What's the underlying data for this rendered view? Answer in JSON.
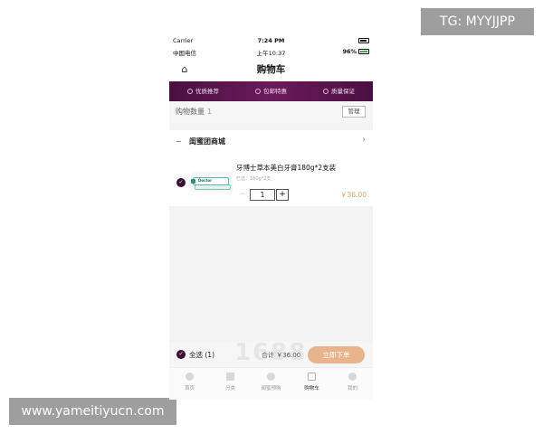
{
  "watermarks": {
    "top_right": "TG: MYYJJPP",
    "bottom_left": "www.yameitiyucn.com"
  },
  "status_bar": {
    "carrier": "Carrier",
    "time": "7:24 PM"
  },
  "status_bar_2": {
    "carrier": "中国电信",
    "time": "上午10:37",
    "battery": "96%"
  },
  "header": {
    "title": "购物车"
  },
  "promo": [
    "优质推荐",
    "包邮特惠",
    "质量保证"
  ],
  "cart_count": {
    "label": "购物数量",
    "count": "1",
    "manage": "管理"
  },
  "shop": {
    "name": "闺蜜团商城",
    "arrow": "›"
  },
  "item": {
    "name": "牙博士草本美白牙膏180g*2支装",
    "spec": "已选：180g*2支",
    "brand": "Doctor",
    "quantity": "1",
    "minus": "−",
    "plus": "+",
    "price": "￥36.00"
  },
  "bottom_bar": {
    "select_all": "全选 (1)",
    "total_label": "合计 ￥36.00",
    "order_button": "立即下单"
  },
  "overlay_text": "1688",
  "tabs": [
    {
      "label": "首页"
    },
    {
      "label": "分类"
    },
    {
      "label": "闺蜜预购"
    },
    {
      "label": "购物车"
    },
    {
      "label": "我的"
    }
  ],
  "colors": {
    "accent": "#5a1a4e",
    "order_button": "#e9b48c",
    "price": "#d9a16b"
  }
}
